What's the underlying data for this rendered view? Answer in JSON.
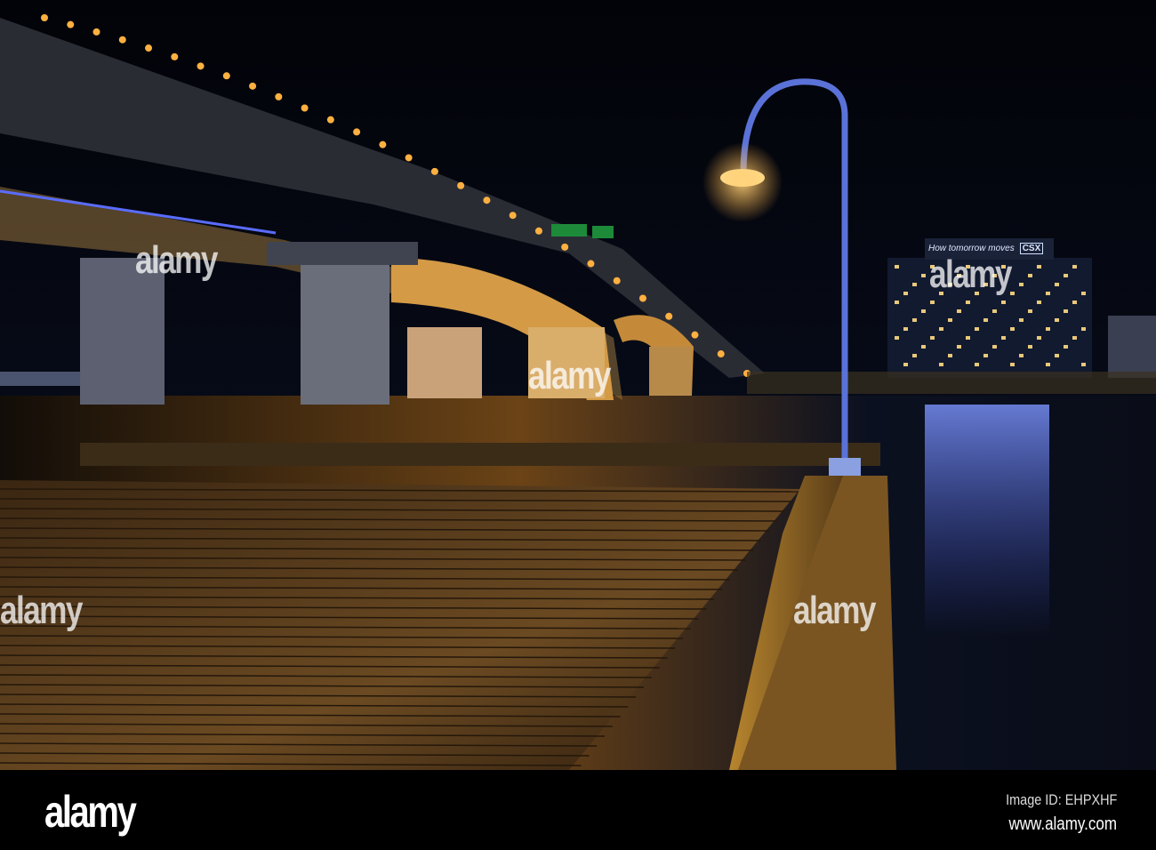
{
  "photo": {
    "building_sign": {
      "slogan": "How tomorrow moves",
      "brand": "CSX"
    },
    "watermark": "alamy"
  },
  "footer": {
    "logo": "alamy",
    "image_id": "Image ID: EHPXHF",
    "url": "www.alamy.com"
  },
  "colors": {
    "sky": "#05070f",
    "bridge_light": "#f2a23a",
    "water_blue": "#4a6cff",
    "dock_wood": "#6b4a22"
  }
}
